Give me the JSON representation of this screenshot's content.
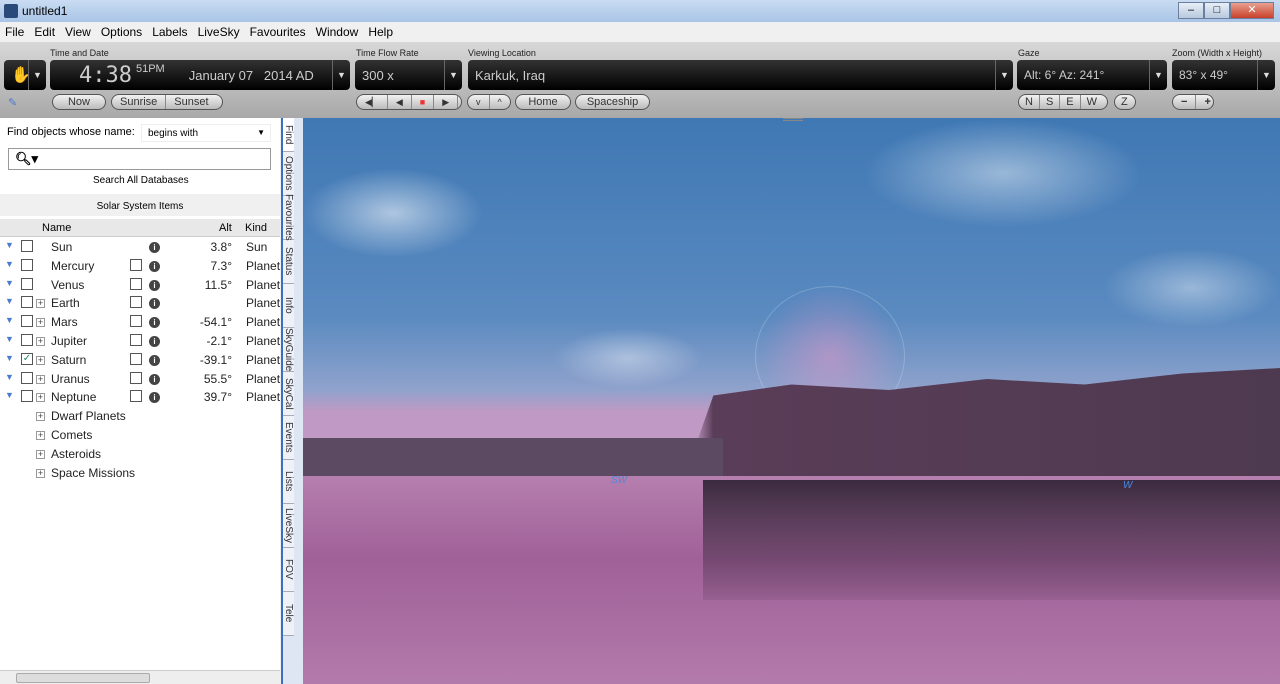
{
  "window": {
    "title": "untitled1"
  },
  "menu": [
    "File",
    "Edit",
    "View",
    "Options",
    "Labels",
    "LiveSky",
    "Favourites",
    "Window",
    "Help"
  ],
  "toolbar": {
    "time_date_label": "Time and Date",
    "time": "4:38",
    "seconds_ampm": "51PM",
    "date": "January 07   2014 AD",
    "now": "Now",
    "sunrise": "Sunrise",
    "sunset": "Sunset",
    "time_flow_label": "Time Flow Rate",
    "time_flow": "300 x",
    "location_label": "Viewing Location",
    "location": "Karkuk, Iraq",
    "home": "Home",
    "spaceship": "Spaceship",
    "gaze_label": "Gaze",
    "gaze": "Alt: 6° Az: 241°",
    "gaze_buttons": [
      "N",
      "S",
      "E",
      "W",
      "Z"
    ],
    "zoom_label": "Zoom (Width x Height)",
    "zoom": "83° x 49°",
    "zoom_out": "−",
    "zoom_in": "+"
  },
  "find": {
    "label": "Find objects whose name:",
    "mode": "begins with",
    "search_value": "",
    "search_all": "Search All Databases",
    "section": "Solar System Items",
    "columns": {
      "name": "Name",
      "alt": "Alt",
      "kind": "Kind"
    },
    "rows": [
      {
        "name": "Sun",
        "alt": "3.8°",
        "kind": "Sun",
        "checked": false,
        "expandable": false
      },
      {
        "name": "Mercury",
        "alt": "7.3°",
        "kind": "Planet",
        "checked": false,
        "expandable": false
      },
      {
        "name": "Venus",
        "alt": "11.5°",
        "kind": "Planet",
        "checked": false,
        "expandable": false
      },
      {
        "name": "Earth",
        "alt": "",
        "kind": "Planet",
        "checked": false,
        "expandable": true
      },
      {
        "name": "Mars",
        "alt": "-54.1°",
        "kind": "Planet",
        "checked": false,
        "expandable": true
      },
      {
        "name": "Jupiter",
        "alt": "-2.1°",
        "kind": "Planet",
        "checked": false,
        "expandable": true
      },
      {
        "name": "Saturn",
        "alt": "-39.1°",
        "kind": "Planet",
        "checked": true,
        "expandable": true
      },
      {
        "name": "Uranus",
        "alt": "55.5°",
        "kind": "Planet",
        "checked": false,
        "expandable": true
      },
      {
        "name": "Neptune",
        "alt": "39.7°",
        "kind": "Planet",
        "checked": false,
        "expandable": true
      }
    ],
    "groups": [
      "Dwarf Planets",
      "Comets",
      "Asteroids",
      "Space Missions"
    ]
  },
  "side_tabs": [
    "Find",
    "Options",
    "Favourites",
    "Status",
    "Info",
    "SkyGuide",
    "SkyCal",
    "Events",
    "Lists",
    "LiveSky",
    "FOV",
    "Tele"
  ],
  "view": {
    "compass": [
      {
        "label": "SW"
      },
      {
        "label": "W"
      }
    ]
  }
}
